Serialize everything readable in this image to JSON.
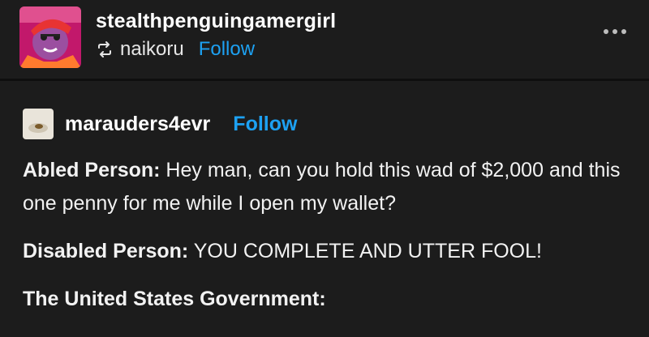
{
  "reblog_header": {
    "username": "stealthpenguingamergirl",
    "reblogged_from": "naikoru",
    "follow_label": "Follow",
    "avatar_icon": "avatar-illustration",
    "reblog_icon": "reblog-icon",
    "more_icon": "more-options-icon"
  },
  "post": {
    "username": "marauders4evr",
    "follow_label": "Follow",
    "avatar_icon": "avatar-photo",
    "dialogue": [
      {
        "speaker": "Abled Person:",
        "line": " Hey man, can you hold this wad of $2,000 and this one penny for me while I open my wallet?"
      },
      {
        "speaker": "Disabled Person:",
        "line": " YOU COMPLETE AND UTTER FOOL!"
      },
      {
        "speaker": "The United States Government:",
        "line": ""
      }
    ]
  },
  "colors": {
    "background": "#1c1c1c",
    "link": "#1da1f2",
    "text": "#ffffff"
  }
}
